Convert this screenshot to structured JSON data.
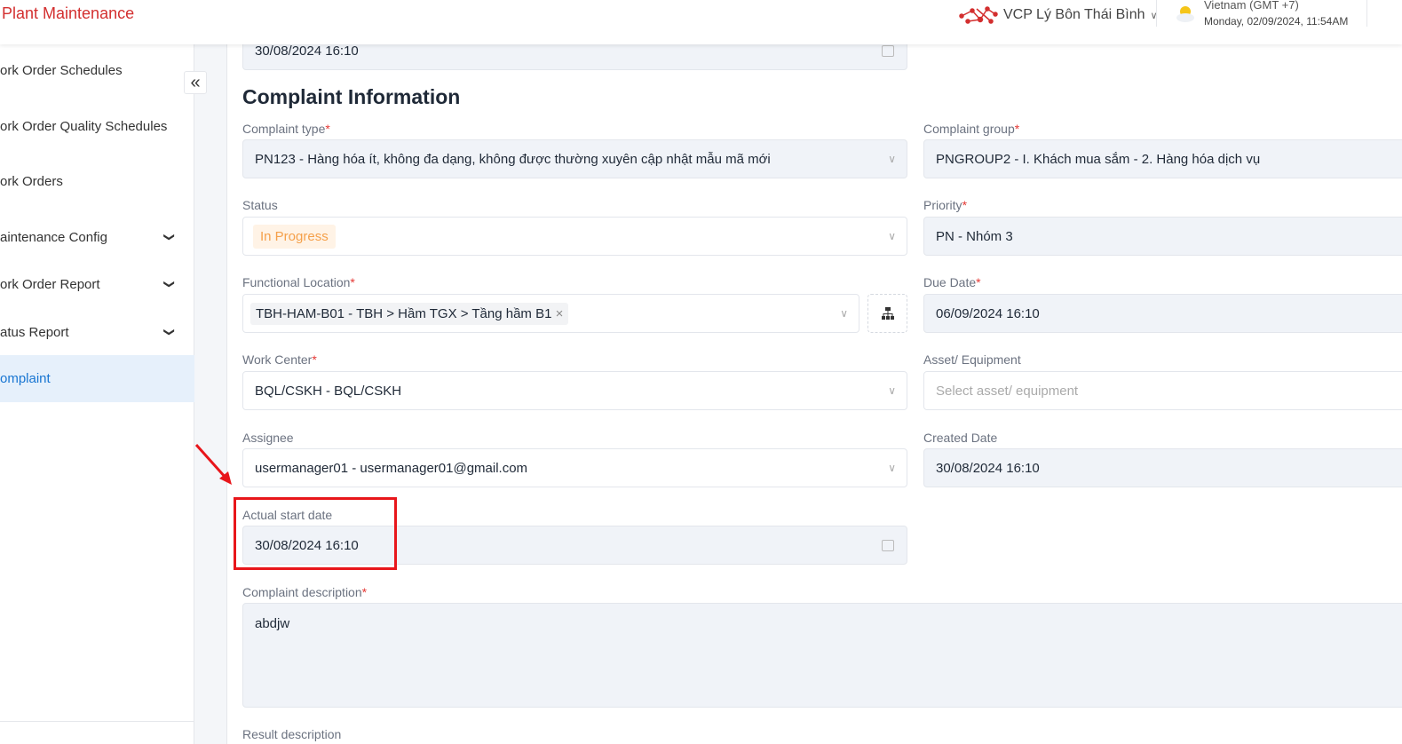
{
  "header": {
    "app_title": "Plant Maintenance",
    "organization": "VCP Lý Bôn Thái Bình",
    "timezone": "Vietnam (GMT +7)",
    "datetime": "Monday, 02/09/2024, 11:54AM"
  },
  "sidebar": {
    "items": [
      {
        "label": "ork Order Schedules"
      },
      {
        "label": "ork Order Quality Schedules"
      },
      {
        "label": "ork Orders"
      },
      {
        "label": "aintenance Config"
      },
      {
        "label": "ork Order Report"
      },
      {
        "label": "atus Report"
      },
      {
        "label": "omplaint",
        "active": true
      }
    ]
  },
  "form": {
    "top_date": "30/08/2024 16:10",
    "section_title": "Complaint Information",
    "complaint_type": {
      "label": "Complaint type",
      "value": "PN123 - Hàng hóa ít, không đa dạng, không được thường xuyên cập nhật mẫu mã mới"
    },
    "complaint_group": {
      "label": "Complaint group",
      "value": "PNGROUP2 - I. Khách mua sắm - 2. Hàng hóa dịch vụ"
    },
    "status": {
      "label": "Status",
      "value": "In Progress",
      "color": "#f5a04a"
    },
    "priority": {
      "label": "Priority",
      "value": "PN - Nhóm 3"
    },
    "functional_location": {
      "label": "Functional Location",
      "value": "TBH-HAM-B01 - TBH > Hầm TGX > Tầng hầm B1"
    },
    "due_date": {
      "label": "Due Date",
      "value": "06/09/2024 16:10"
    },
    "work_center": {
      "label": "Work Center",
      "value": "BQL/CSKH - BQL/CSKH"
    },
    "asset": {
      "label": "Asset/ Equipment",
      "placeholder": "Select asset/ equipment"
    },
    "assignee": {
      "label": "Assignee",
      "value": "usermanager01 - usermanager01@gmail.com"
    },
    "created_date": {
      "label": "Created Date",
      "value": "30/08/2024 16:10"
    },
    "actual_start": {
      "label": "Actual start date",
      "value": "30/08/2024 16:10"
    },
    "complaint_description": {
      "label": "Complaint description",
      "value": "abdjw"
    },
    "result_description": {
      "label": "Result description"
    }
  },
  "annotation_color": "#e8161b"
}
